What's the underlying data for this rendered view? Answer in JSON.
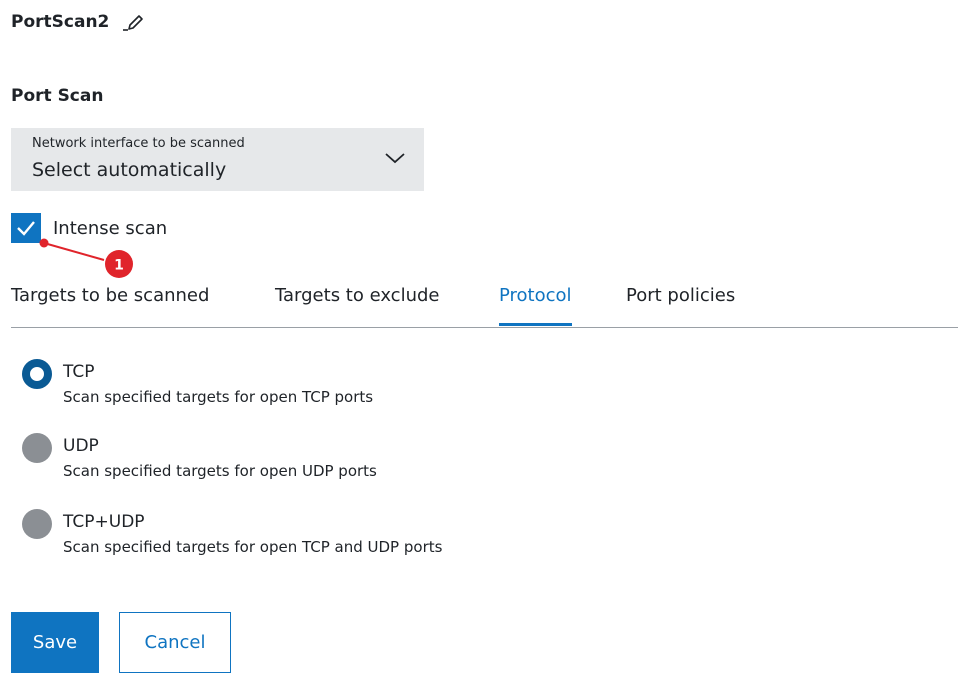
{
  "header": {
    "title": "PortScan2",
    "edit_icon": "pencil-icon"
  },
  "section": {
    "title": "Port Scan"
  },
  "network_select": {
    "label": "Network interface to be scanned",
    "value": "Select automatically",
    "icon": "chevron-down-icon"
  },
  "intense_scan": {
    "label": "Intense scan",
    "checked": true
  },
  "annotation": {
    "number": "1",
    "color": "#e0242b"
  },
  "tabs": [
    {
      "label": "Targets to be scanned",
      "active": false
    },
    {
      "label": "Targets to exclude",
      "active": false
    },
    {
      "label": "Protocol",
      "active": true
    },
    {
      "label": "Port policies",
      "active": false
    }
  ],
  "protocols": [
    {
      "label": "TCP",
      "description": "Scan specified targets for open TCP ports",
      "selected": true
    },
    {
      "label": "UDP",
      "description": "Scan specified targets for open UDP ports",
      "selected": false
    },
    {
      "label": "TCP+UDP",
      "description": "Scan specified targets for open TCP and UDP ports",
      "selected": false
    }
  ],
  "actions": {
    "save_label": "Save",
    "cancel_label": "Cancel"
  },
  "colors": {
    "accent": "#0f74c1",
    "radio_selected": "#0a5a94",
    "radio_unselected": "#8b8f94",
    "select_bg": "#e6e8ea"
  }
}
